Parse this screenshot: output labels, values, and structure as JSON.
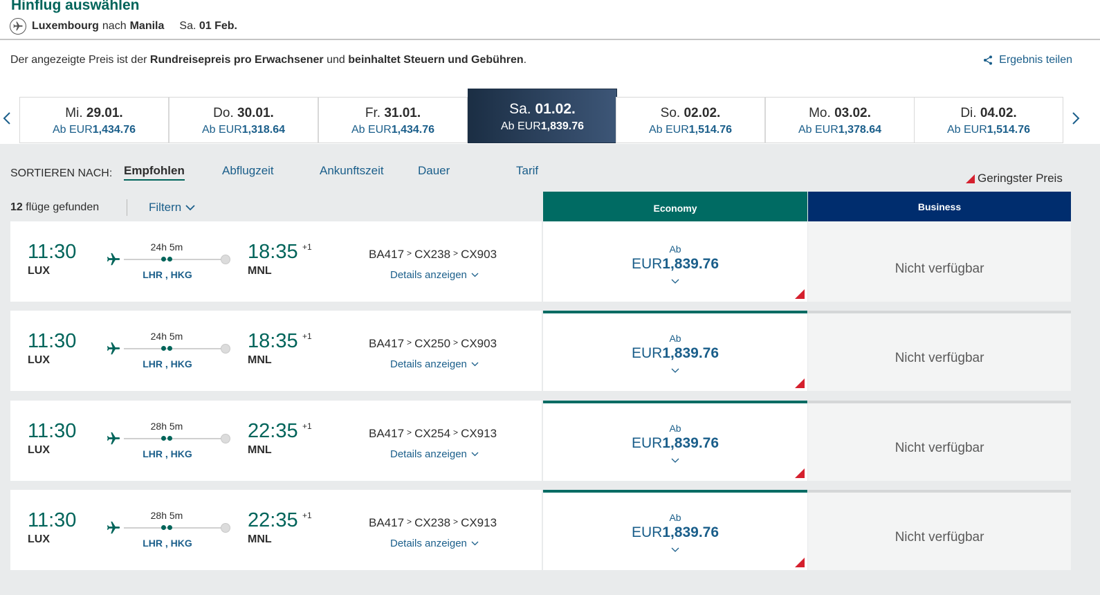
{
  "header": {
    "title": "Hinflug auswählen",
    "origin": "Luxembourg",
    "connector": "nach",
    "destination": "Manila",
    "day": "Sa.",
    "date": "01 Feb."
  },
  "info": {
    "prefix": "Der angezeigte Preis ist der",
    "bold1": "Rundreisepreis pro Erwachsener",
    "middle": "und",
    "bold2": "beinhaltet Steuern und Gebühren",
    "suffix": ".",
    "share_label": "Ergebnis teilen"
  },
  "dates": [
    {
      "day": "Mi.",
      "date": "29.01.",
      "prefix": "Ab EUR",
      "price": "1,434.76",
      "active": false
    },
    {
      "day": "Do.",
      "date": "30.01.",
      "prefix": "Ab EUR",
      "price": "1,318.64",
      "active": false
    },
    {
      "day": "Fr.",
      "date": "31.01.",
      "prefix": "Ab EUR",
      "price": "1,434.76",
      "active": false
    },
    {
      "day": "Sa.",
      "date": "01.02.",
      "prefix": "Ab EUR",
      "price": "1,839.76",
      "active": true
    },
    {
      "day": "So.",
      "date": "02.02.",
      "prefix": "Ab EUR",
      "price": "1,514.76",
      "active": false
    },
    {
      "day": "Mo.",
      "date": "03.02.",
      "prefix": "Ab EUR",
      "price": "1,378.64",
      "active": false
    },
    {
      "day": "Di.",
      "date": "04.02.",
      "prefix": "Ab EUR",
      "price": "1,514.76",
      "active": false
    }
  ],
  "sort": {
    "label": "SORTIEREN NACH:",
    "options": [
      "Empfohlen",
      "Abflugzeit",
      "Ankunftszeit",
      "Dauer",
      "Tarif"
    ],
    "active": "Empfohlen"
  },
  "legend": {
    "lowest_price": "Geringster Preis"
  },
  "results": {
    "count": "12",
    "label": "flüge gefunden",
    "filter_label": "Filtern"
  },
  "cabins": {
    "economy": "Economy",
    "business": "Business"
  },
  "flights": [
    {
      "dep_time": "11:30",
      "dep_code": "LUX",
      "duration": "24h 5m",
      "stops": "LHR , HKG",
      "arr_time": "18:35",
      "day_offset": "+1",
      "arr_code": "MNL",
      "flight_numbers": [
        "BA417",
        "CX238",
        "CX903"
      ],
      "details_label": "Details anzeigen",
      "econ_from": "Ab",
      "econ_currency": "EUR",
      "econ_price": "1,839.76",
      "business": "Nicht verfügbar"
    },
    {
      "dep_time": "11:30",
      "dep_code": "LUX",
      "duration": "24h 5m",
      "stops": "LHR , HKG",
      "arr_time": "18:35",
      "day_offset": "+1",
      "arr_code": "MNL",
      "flight_numbers": [
        "BA417",
        "CX250",
        "CX903"
      ],
      "details_label": "Details anzeigen",
      "econ_from": "Ab",
      "econ_currency": "EUR",
      "econ_price": "1,839.76",
      "business": "Nicht verfügbar"
    },
    {
      "dep_time": "11:30",
      "dep_code": "LUX",
      "duration": "28h 5m",
      "stops": "LHR , HKG",
      "arr_time": "22:35",
      "day_offset": "+1",
      "arr_code": "MNL",
      "flight_numbers": [
        "BA417",
        "CX254",
        "CX913"
      ],
      "details_label": "Details anzeigen",
      "econ_from": "Ab",
      "econ_currency": "EUR",
      "econ_price": "1,839.76",
      "business": "Nicht verfügbar"
    },
    {
      "dep_time": "11:30",
      "dep_code": "LUX",
      "duration": "28h 5m",
      "stops": "LHR , HKG",
      "arr_time": "22:35",
      "day_offset": "+1",
      "arr_code": "MNL",
      "flight_numbers": [
        "BA417",
        "CX238",
        "CX913"
      ],
      "details_label": "Details anzeigen",
      "econ_from": "Ab",
      "econ_currency": "EUR",
      "econ_price": "1,839.76",
      "business": "Nicht verfügbar"
    }
  ],
  "colors": {
    "brand_green": "#00645a",
    "business_navy": "#002d6e",
    "link_blue": "#1a5e8a",
    "lowest_marker": "#d5202e"
  }
}
